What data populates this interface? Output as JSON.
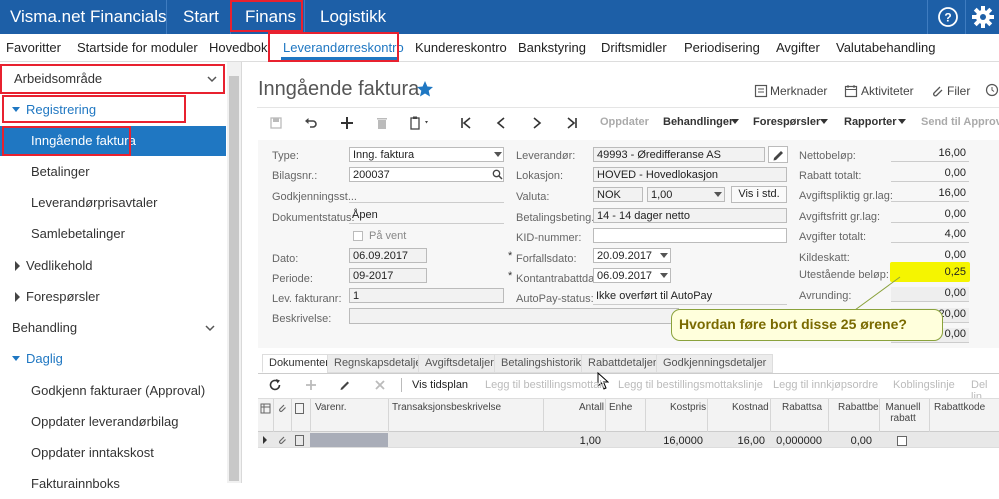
{
  "topbar": {
    "brand": "Visma.net Financials",
    "modules": [
      "Start",
      "Finans",
      "Logistikk"
    ]
  },
  "menubar": {
    "items": [
      "Favoritter",
      "Startside for moduler",
      "Hovedbok",
      "Leverandørreskontro",
      "Kundereskontro",
      "Bankstyring",
      "Driftsmidler",
      "Periodisering",
      "Avgifter",
      "Valutabehandling"
    ]
  },
  "sidebar": {
    "workspace": "Arbeidsområde",
    "registrering": "Registrering",
    "items1": [
      "Inngående faktura",
      "Betalinger",
      "Leverandørprisavtaler",
      "Samlebetalinger"
    ],
    "vedlikehold": "Vedlikehold",
    "foresporsler": "Forespørsler",
    "behandling": "Behandling",
    "daglig": "Daglig",
    "items2": [
      "Godkjenn fakturaer (Approval)",
      "Oppdater leverandørbilag",
      "Oppdater inntakskost",
      "Fakturainnboks"
    ]
  },
  "page": {
    "title": "Inngående faktura",
    "merknader": "Merknader",
    "aktiviteter": "Aktiviteter",
    "filer": "Filer"
  },
  "toolbar": {
    "oppdater": "Oppdater",
    "behandlinger": "Behandlinger",
    "foresporsler": "Forespørsler",
    "rapporter": "Rapporter",
    "send": "Send til Approval"
  },
  "form": {
    "type_label": "Type:",
    "type_value": "Inng. faktura",
    "bilag_label": "Bilagsnr.:",
    "bilag_value": "200037",
    "godkj_label": "Godkjenningsst...",
    "status_label": "Dokumentstatus:",
    "status_value": "Åpen",
    "paavent": "På vent",
    "dato_label": "Dato:",
    "dato_value": "06.09.2017",
    "periode_label": "Periode:",
    "periode_value": "09-2017",
    "levfakt_label": "Lev. fakturanr:",
    "levfakt_value": "1",
    "beskr_label": "Beskrivelse:",
    "lev_label": "Leverandør:",
    "lev_value": "49993 - Øredifferanse AS",
    "lok_label": "Lokasjon:",
    "lok_value": "HOVED - Hovedlokasjon",
    "valuta_label": "Valuta:",
    "valuta_value": "NOK",
    "kurs_value": "1,00",
    "vis_btn": "Vis i std.",
    "betbet_label": "Betalingsbeting...",
    "betbet_value": "14 - 14 dager netto",
    "kid_label": "KID-nummer:",
    "forfall_label": "Forfallsdato:",
    "forfall_value": "20.09.2017",
    "kontant_label": "Kontantrabattdato:",
    "kontant_value": "06.09.2017",
    "autopay_label": "AutoPay-status:",
    "autopay_value": "Ikke overført til AutoPay"
  },
  "totals": [
    {
      "label": "Nettobeløp:",
      "value": "16,00"
    },
    {
      "label": "Rabatt totalt:",
      "value": "0,00"
    },
    {
      "label": "Avgiftspliktig gr.lag:",
      "value": "16,00"
    },
    {
      "label": "Avgiftsfritt gr.lag:",
      "value": "0,00"
    },
    {
      "label": "Avgifter totalt:",
      "value": "4,00"
    },
    {
      "label": "Kildeskatt:",
      "value": "0,00"
    },
    {
      "label": "Utestående beløp:",
      "value": "0,25"
    },
    {
      "label": "Avrunding:",
      "value": "0,00"
    }
  ],
  "hidden_totals": [
    "20,00",
    "0,00"
  ],
  "callout": "Hvordan føre bort disse 25 ørene?",
  "tabs": [
    "Dokumenter",
    "Regnskapsdetaljer",
    "Avgiftsdetaljer",
    "Betalingshistorikk",
    "Rabattdetaljer",
    "Godkjenningsdetaljer"
  ],
  "gridtoolbar": {
    "vis": "Vis tidsplan",
    "b1": "Legg til bestillingsmottak",
    "b2": "Legg til bestillingsmottakslinje",
    "b3": "Legg til innkjøpsordre",
    "b4": "Koblingslinje",
    "b5": "Del lin"
  },
  "grid": {
    "headers": [
      "Varenr.",
      "Transaksjonsbeskrivelse",
      "Antall",
      "Enhe",
      "Kostpris",
      "Kostnad",
      "Rabattsa",
      "Rabattbe",
      "Manuell rabatt",
      "Rabattkode"
    ],
    "row": {
      "antall": "1,00",
      "kostpris": "16,0000",
      "kostnad": "16,00",
      "rabattsats": "0,000000",
      "rabattbelop": "0,00"
    }
  },
  "colors": {
    "topbar": "#1d5fa7",
    "active": "#1f77c2",
    "highlight": "#f5f500",
    "callout_text": "#7a6a00",
    "callout_border": "#8aa23c",
    "red": "#e8212f"
  }
}
